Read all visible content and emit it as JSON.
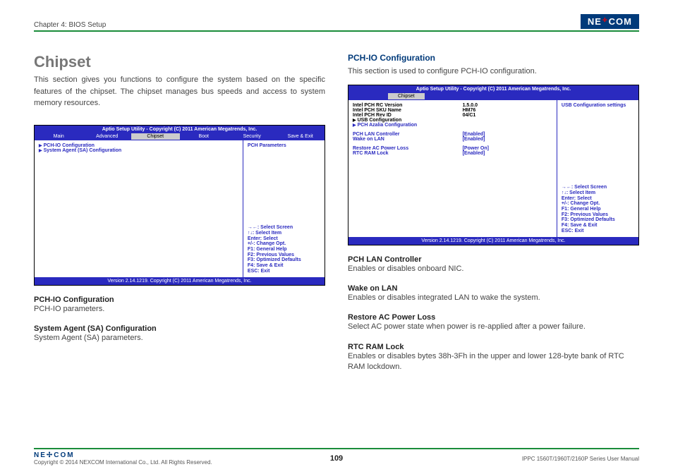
{
  "chapter": "Chapter 4: BIOS Setup",
  "logo_brand": "NE COM",
  "left": {
    "title": "Chipset",
    "intro": "This section gives you functions to configure the system based on the specific features of the chipset. The chipset manages bus speeds and access to system memory resources.",
    "bios": {
      "header": "Aptio Setup Utility - Copyright (C) 2011 American Megatrends, Inc.",
      "tabs": [
        "Main",
        "Advanced",
        "Chipset",
        "Boot",
        "Security",
        "Save & Exit"
      ],
      "items": [
        "PCH-IO Configuration",
        "System Agent (SA) Configuration"
      ],
      "side_top": "PCH Parameters",
      "help": [
        "→←: Select Screen",
        "↑↓: Select Item",
        "Enter: Select",
        "+/-: Change Opt.",
        "F1: General Help",
        "F2: Previous Values",
        "F3: Optimized Defaults",
        "F4: Save & Exit",
        "ESC: Exit"
      ],
      "footer": "Version 2.14.1219. Copyright (C) 2011 American Megatrends, Inc."
    },
    "desc": [
      {
        "t": "PCH-IO Configuration",
        "d": "PCH-IO parameters."
      },
      {
        "t": "System Agent (SA) Configuration",
        "d": "System Agent (SA) parameters."
      }
    ]
  },
  "right": {
    "title": "PCH-IO Configuration",
    "intro": "This section is used to configure PCH-IO configuration.",
    "bios": {
      "header": "Aptio Setup Utility - Copyright (C) 2011 American Megatrends, Inc.",
      "tab": "Chipset",
      "info": [
        {
          "l": "Intel PCH RC Version",
          "v": "1.5.0.0"
        },
        {
          "l": "Intel PCH SKU Name",
          "v": "HM76"
        },
        {
          "l": "Intel PCH Rev ID",
          "v": "04/C1"
        }
      ],
      "sub": [
        "USB Configuration",
        "PCH Azalia Configuration"
      ],
      "settings": [
        {
          "l": "PCH LAN Controller",
          "v": "[Enabled]"
        },
        {
          "l": "  Wake on LAN",
          "v": "[Enabled]"
        },
        {
          "l": "Restore AC Power Loss",
          "v": "[Power On]"
        },
        {
          "l": "RTC RAM Lock",
          "v": "[Enabled]"
        }
      ],
      "side_top": "USB Configuration settings",
      "help": [
        "→←: Select Screen",
        "↑↓: Select Item",
        "Enter: Select",
        "+/-: Change Opt.",
        "F1: General Help",
        "F2: Previous Values",
        "F3: Optimized Defaults",
        "F4: Save & Exit",
        "ESC: Exit"
      ],
      "footer": "Version 2.14.1219. Copyright (C) 2011 American Megatrends, Inc."
    },
    "desc": [
      {
        "t": "PCH LAN Controller",
        "d": "Enables or disables onboard NIC."
      },
      {
        "t": "Wake on LAN",
        "d": "Enables or disables integrated LAN to wake the system."
      },
      {
        "t": "Restore AC Power Loss",
        "d": "Select AC power state when power is re-applied after a power failure."
      },
      {
        "t": "RTC RAM Lock",
        "d": "Enables or disables bytes 38h-3Fh in the upper and lower 128-byte bank of RTC RAM lockdown."
      }
    ]
  },
  "footer": {
    "copyright": "Copyright © 2014 NEXCOM International Co., Ltd. All Rights Reserved.",
    "page": "109",
    "doc": "IPPC 1560T/1960T/2160P Series User Manual"
  }
}
